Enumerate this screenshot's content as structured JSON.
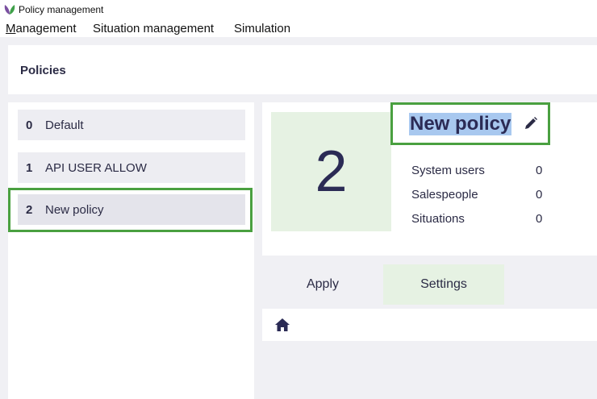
{
  "window": {
    "title": "Policy management"
  },
  "menu": {
    "items": [
      "Management",
      "Situation management",
      "Simulation"
    ]
  },
  "page": {
    "title": "Policies"
  },
  "policies": [
    {
      "number": "0",
      "name": "Default"
    },
    {
      "number": "1",
      "name": "API USER ALLOW"
    },
    {
      "number": "2",
      "name": "New policy"
    }
  ],
  "selected_policy": {
    "number": "2",
    "name": "New policy",
    "stats": [
      {
        "label": "System users",
        "value": "0"
      },
      {
        "label": "Salespeople",
        "value": "0"
      },
      {
        "label": "Situations",
        "value": "0"
      }
    ]
  },
  "tabs": [
    {
      "label": "Apply",
      "active": false
    },
    {
      "label": "Settings",
      "active": true
    }
  ],
  "icons": {
    "app_logo": "leaf-logo-icon",
    "edit": "pencil-icon",
    "home": "home-icon"
  },
  "colors": {
    "highlight_border": "#4aa040",
    "active_tab_bg": "#e6f2e3",
    "text_selection": "#a8c8ef",
    "logo": "#7a4fa0"
  }
}
